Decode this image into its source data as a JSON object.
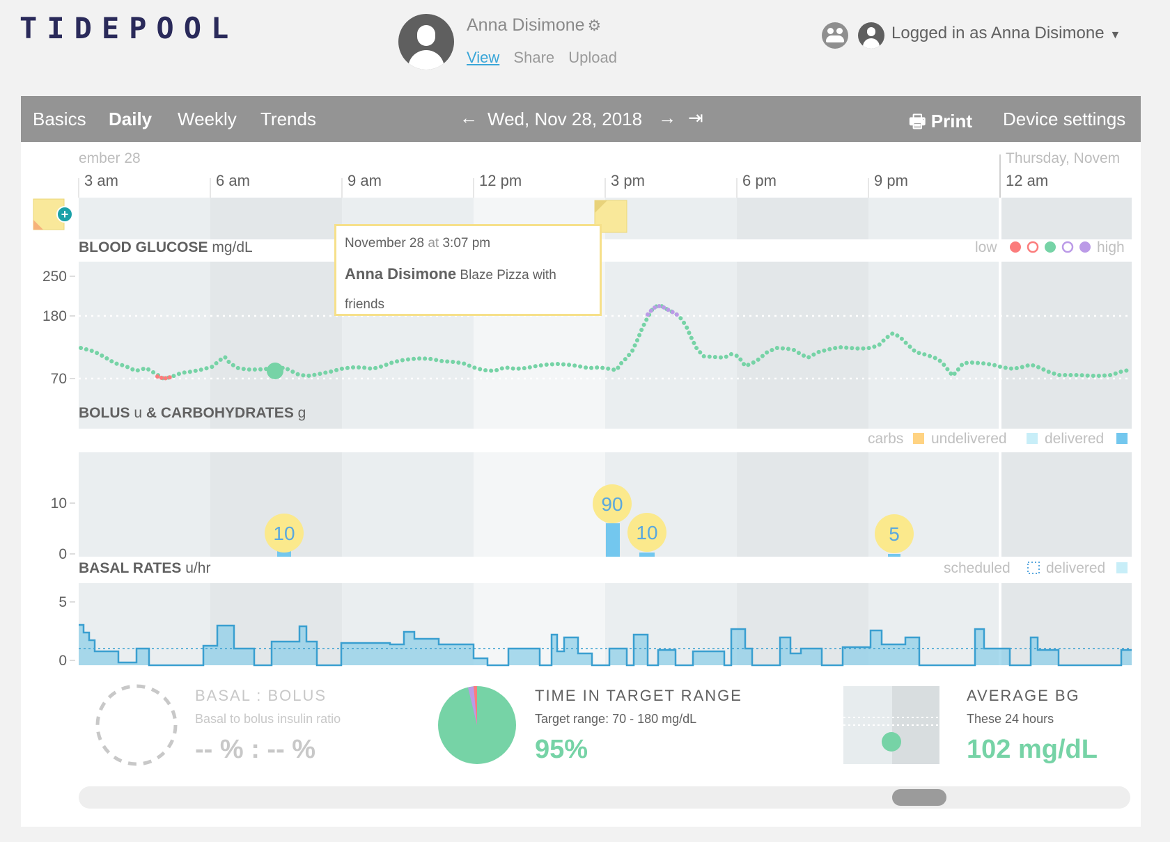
{
  "header": {
    "logo_text": "TIDEPOOL",
    "patient_name": "Anna Disimone",
    "links": [
      "View",
      "Share",
      "Upload"
    ],
    "active_link": "View",
    "logged_in_text": "Logged in as Anna Disimone"
  },
  "nav": {
    "tabs": [
      "Basics",
      "Daily",
      "Weekly",
      "Trends"
    ],
    "active_tab": "Daily",
    "date": "Wed, Nov 28, 2018",
    "print_label": "Print",
    "device_settings_label": "Device settings"
  },
  "timeline": {
    "day_left": "ember 28",
    "day_right": "Thursday, Novem",
    "hours": [
      "3 am",
      "6 am",
      "9 am",
      "12 pm",
      "3 pm",
      "6 pm",
      "9 pm",
      "12 am"
    ]
  },
  "tooltip": {
    "date": "November 28",
    "at": "at",
    "time": "3:07 pm",
    "author": "Anna Disimone",
    "message": "Blaze Pizza with friends"
  },
  "bg": {
    "title": "BLOOD GLUCOSE",
    "unit": "mg/dL",
    "legend_low": "low",
    "legend_high": "high",
    "ticks": [
      "250",
      "180",
      "70"
    ],
    "colors": {
      "low": "#fb7c7c",
      "target": "#76d3a6",
      "high": "#bb9ae7"
    }
  },
  "bolus": {
    "title": "BOLUS",
    "unit1": "u",
    "amp": "& CARBOHYDRATES",
    "unit2": "g",
    "legend": [
      "carbs",
      "undelivered",
      "delivered"
    ],
    "ticks": [
      "10",
      "0"
    ],
    "carbs": [
      "10",
      "90",
      "10",
      "5"
    ]
  },
  "basal": {
    "title": "BASAL RATES",
    "unit": "u/hr",
    "legend": [
      "scheduled",
      "delivered"
    ],
    "ticks": [
      "5",
      "0"
    ]
  },
  "stats": {
    "basal_bolus": {
      "title": "BASAL : BOLUS",
      "sub": "Basal to bolus insulin ratio",
      "value": "-- % : -- %"
    },
    "tir": {
      "title": "TIME IN TARGET RANGE",
      "sub": "Target range: 70 - 180 mg/dL",
      "value": "95%",
      "percent": 95
    },
    "avg": {
      "title": "AVERAGE BG",
      "sub": "These 24 hours",
      "value": "102 mg/dL"
    }
  }
}
